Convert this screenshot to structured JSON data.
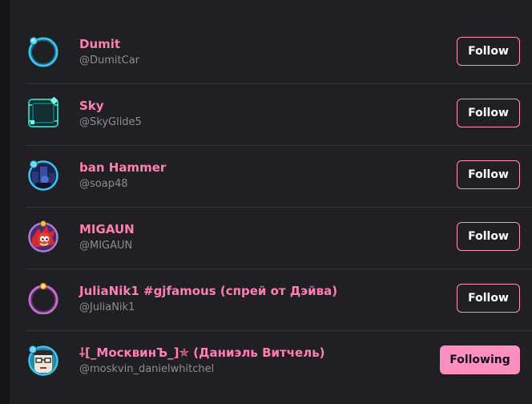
{
  "colors": {
    "background": "#1f1f24",
    "name": "#ff7eb6",
    "handle": "#8c8c94",
    "accent": "#ff8fbf",
    "divider": "#34343a"
  },
  "users": [
    {
      "name": "Dumit",
      "handle": "@DumitCar",
      "button": "Follow",
      "avatar_icon": "cyan-ring-frame-icon"
    },
    {
      "name": "Sky",
      "handle": "@SkyGlide5",
      "button": "Follow",
      "avatar_icon": "teal-square-frame-icon"
    },
    {
      "name": "ban Hammer",
      "handle": "@soap48",
      "button": "Follow",
      "avatar_icon": "night-scene-avatar-icon"
    },
    {
      "name": "MIGAUN",
      "handle": "@MIGAUN",
      "button": "Follow",
      "avatar_icon": "red-hedgehog-avatar-icon"
    },
    {
      "name": "JuliaNik1 #gjfamous (спрей от Дэйва)",
      "handle": "@JuliaNik1",
      "button": "Follow",
      "avatar_icon": "pink-ring-frame-icon"
    },
    {
      "name": "⸸[_МосквинЪ_]✯ (Даниэль Витчель)",
      "handle": "@moskvin_danielwhitchel",
      "button": "Following",
      "avatar_icon": "glasses-character-avatar-icon"
    }
  ]
}
